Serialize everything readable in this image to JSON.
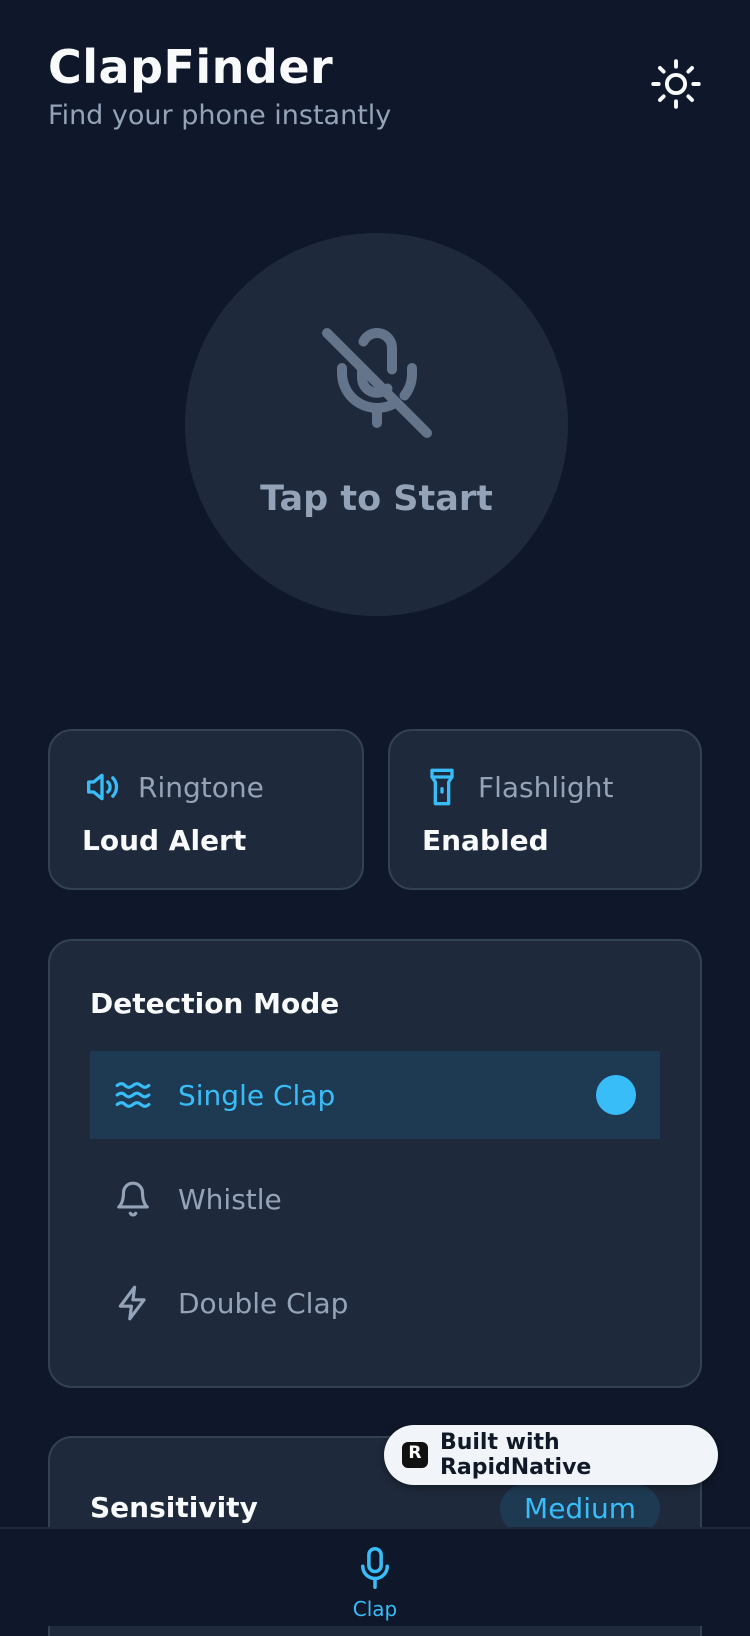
{
  "app": {
    "title": "ClapFinder",
    "subtitle": "Find your phone instantly"
  },
  "theme_toggle": {
    "icon": "sun-icon"
  },
  "start_button": {
    "label": "Tap to Start",
    "icon": "mic-off-icon"
  },
  "ringtone": {
    "label": "Ringtone",
    "value": "Loud Alert",
    "icon": "speaker-icon"
  },
  "flashlight": {
    "label": "Flashlight",
    "value": "Enabled",
    "icon": "flashlight-icon"
  },
  "detection_mode": {
    "title": "Detection Mode",
    "options": [
      {
        "label": "Single Clap",
        "icon": "waves-icon",
        "selected": true
      },
      {
        "label": "Whistle",
        "icon": "bell-icon",
        "selected": false
      },
      {
        "label": "Double Clap",
        "icon": "lightning-icon",
        "selected": false
      }
    ]
  },
  "sensitivity": {
    "title": "Sensitivity",
    "value": "Medium"
  },
  "built_with": {
    "label": "Built with RapidNative",
    "logo_letter": "R"
  },
  "tabbar": {
    "items": [
      {
        "label": "Clap",
        "icon": "mic-icon",
        "active": true
      }
    ]
  },
  "colors": {
    "background": "#0f172a",
    "card": "#1e293b",
    "accent": "#38bdf8",
    "muted": "#94a3b8"
  }
}
